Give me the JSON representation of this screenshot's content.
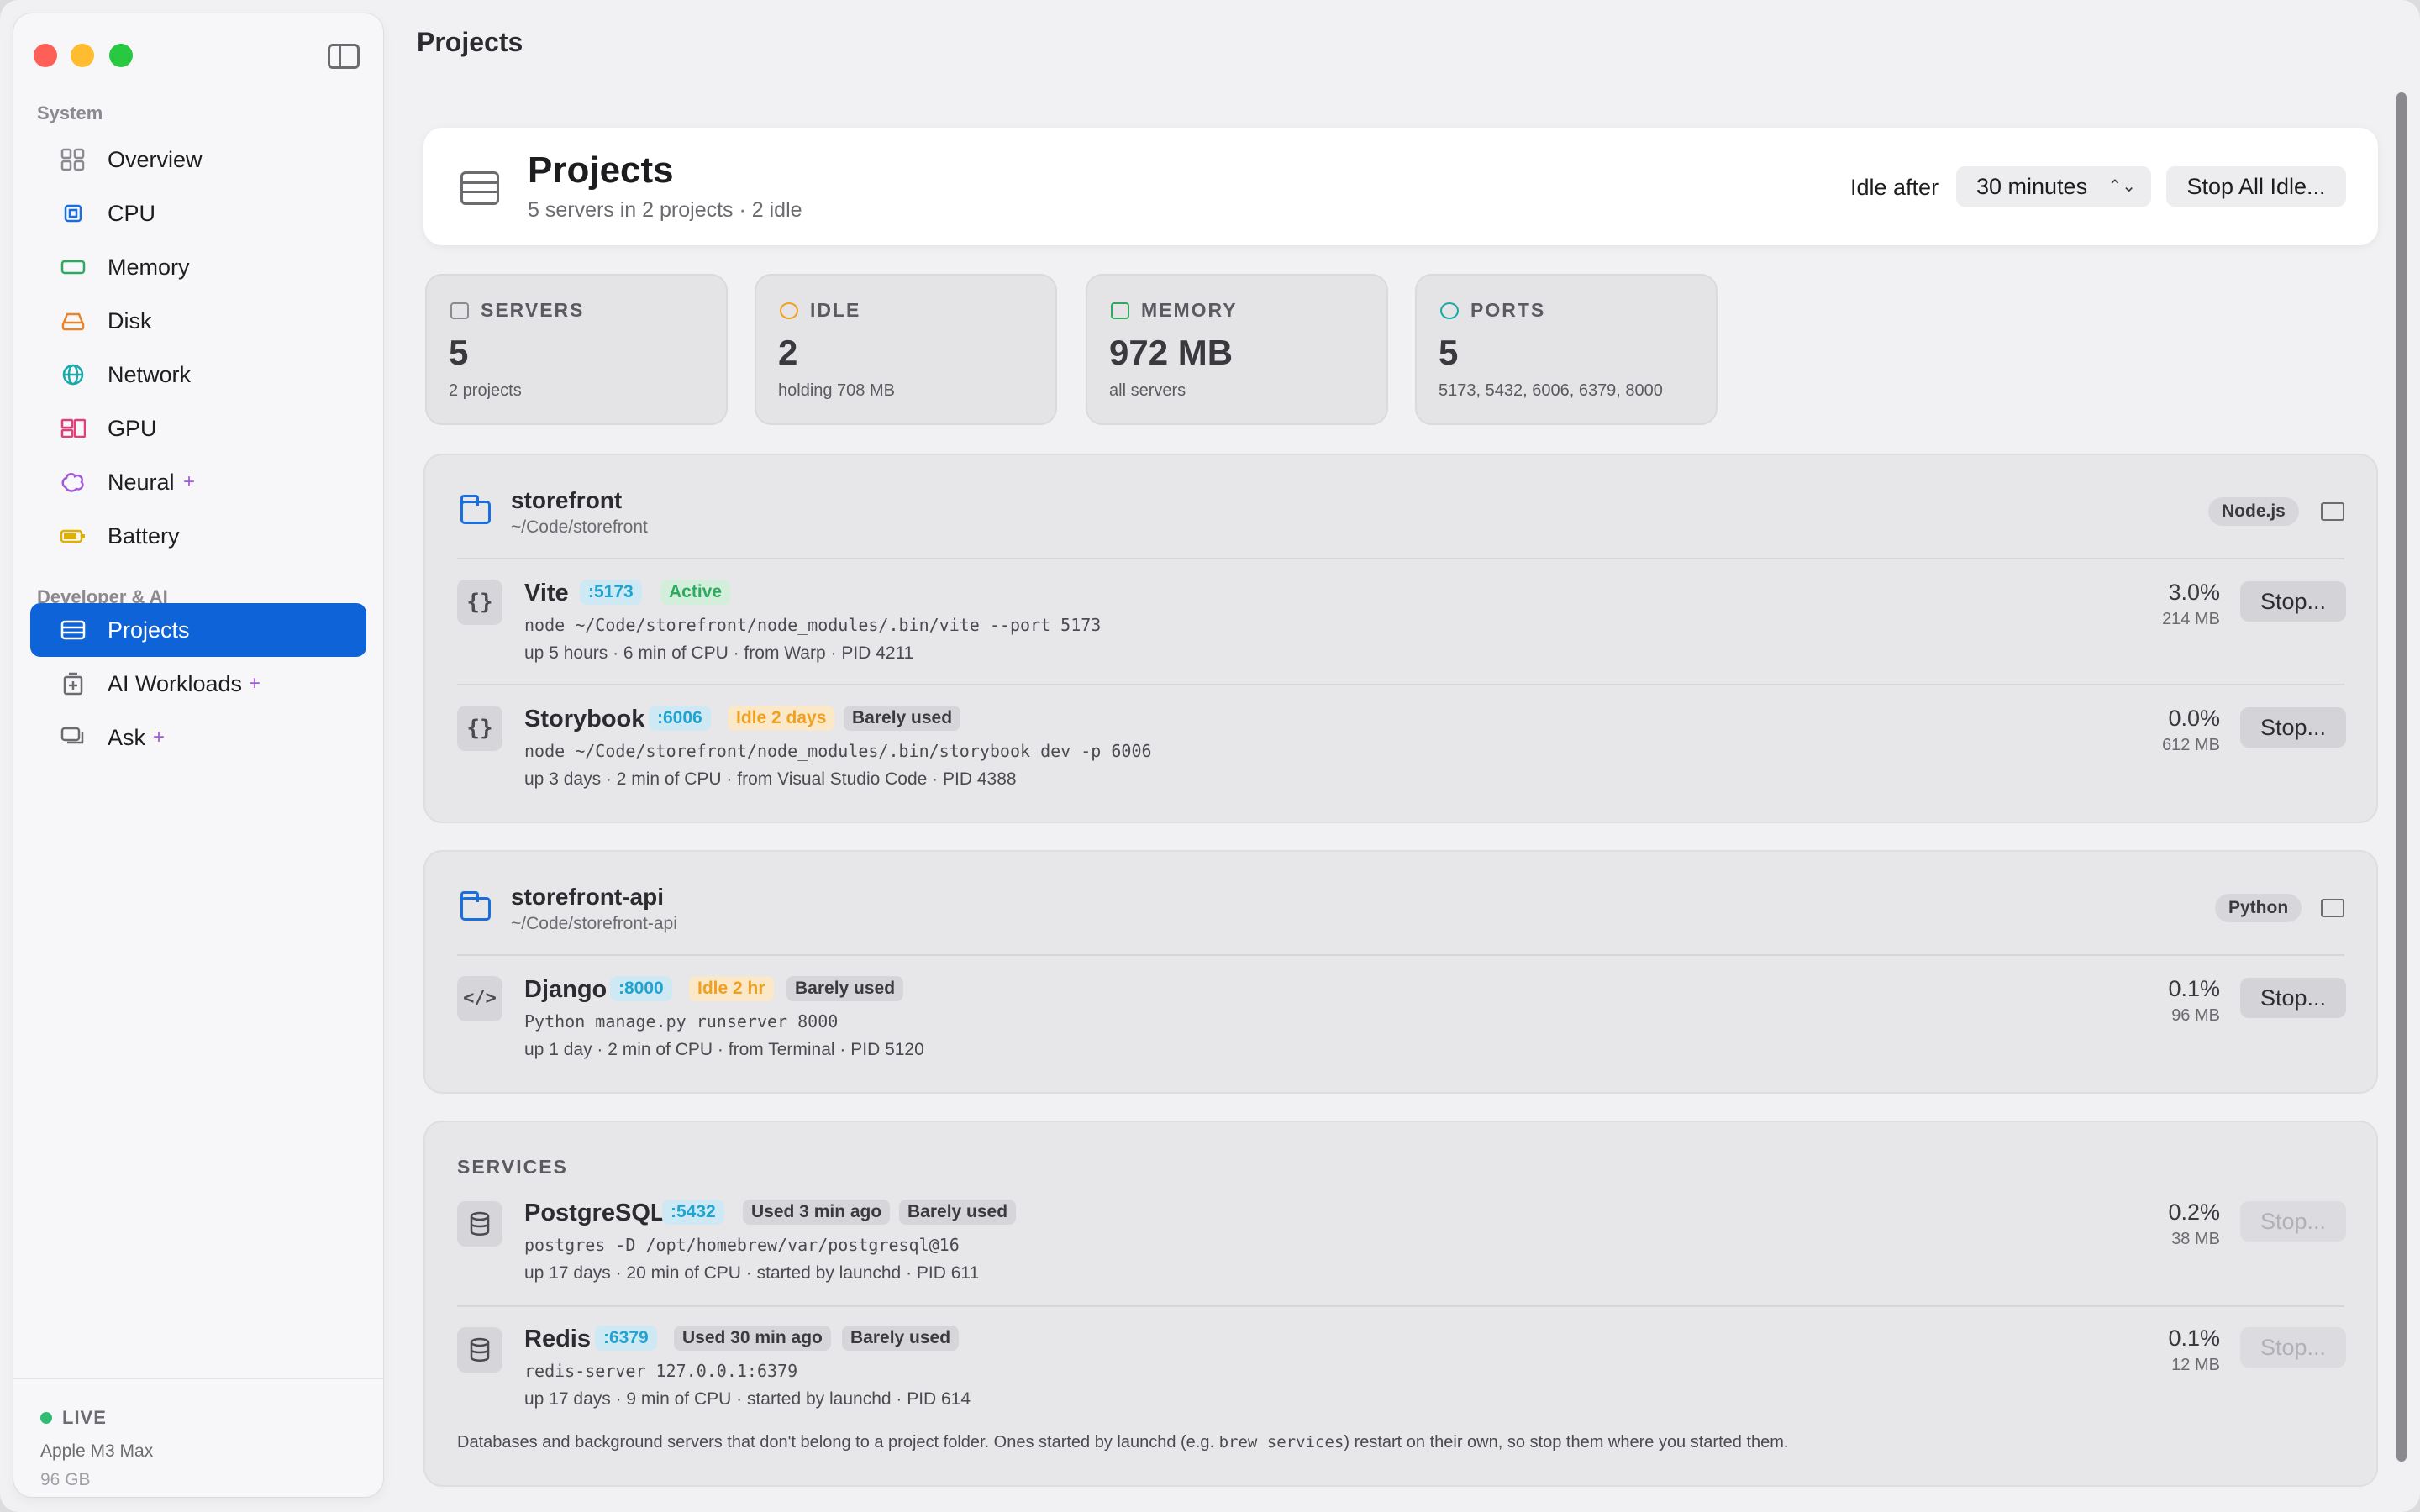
{
  "window": {
    "title": "Projects"
  },
  "colors": {
    "accent": "#0f63d8",
    "live": "#2ebd73",
    "port": "#1fa3d1",
    "active": "#2eaa5e",
    "idle": "#f0a020",
    "sparkle": "#a259d9"
  },
  "sidebar": {
    "sections": [
      {
        "label": "System"
      },
      {
        "label": "Developer & AI"
      }
    ],
    "items": [
      {
        "label": "Overview",
        "icon": "grid-icon"
      },
      {
        "label": "CPU",
        "icon": "chip-icon"
      },
      {
        "label": "Memory",
        "icon": "memory-icon"
      },
      {
        "label": "Disk",
        "icon": "disk-icon"
      },
      {
        "label": "Network",
        "icon": "globe-icon"
      },
      {
        "label": "GPU",
        "icon": "gpu-icon"
      },
      {
        "label": "Neural",
        "icon": "brain-icon",
        "sparkle": "+"
      },
      {
        "label": "Battery",
        "icon": "battery-icon"
      },
      {
        "label": "Projects",
        "icon": "server-icon",
        "active": true
      },
      {
        "label": "AI Workloads",
        "icon": "ai-icon",
        "sparkle": "+"
      },
      {
        "label": "Ask",
        "icon": "chat-icon",
        "sparkle": "+"
      }
    ],
    "footer": {
      "live": "LIVE",
      "chip": "Apple M3 Max",
      "memory": "96 GB"
    }
  },
  "header": {
    "title": "Projects",
    "subtitle": "5 servers in 2 projects · 2 idle",
    "idle_label": "Idle after",
    "idle_value": "30 minutes",
    "stop_all": "Stop All Idle..."
  },
  "stats": [
    {
      "label": "SERVERS",
      "value": "5",
      "sub": "2 projects"
    },
    {
      "label": "IDLE",
      "value": "2",
      "sub": "holding 708 MB"
    },
    {
      "label": "MEMORY",
      "value": "972 MB",
      "sub": "all servers"
    },
    {
      "label": "PORTS",
      "value": "5",
      "sub": "5173, 5432, 6006, 6379, 8000"
    }
  ],
  "groups": [
    {
      "name": "storefront",
      "path": "~/Code/storefront",
      "lang": "Node.js",
      "rows": [
        {
          "icon": "{}",
          "name": "Vite",
          "port": ":5173",
          "status": "Active",
          "cmd": "node ~/Code/storefront/node_modules/.bin/vite --port 5173",
          "meta": "up 5 hours · 6 min of CPU · from Warp · PID 4211",
          "cpu": "3.0%",
          "mem": "214 MB",
          "stop": "Stop..."
        },
        {
          "icon": "{}",
          "name": "Storybook",
          "port": ":6006",
          "status": "Idle 2 days",
          "usage": "Barely used",
          "cmd": "node ~/Code/storefront/node_modules/.bin/storybook dev -p 6006",
          "meta": "up 3 days · 2 min of CPU · from Visual Studio Code · PID 4388",
          "cpu": "0.0%",
          "mem": "612 MB",
          "stop": "Stop..."
        }
      ]
    },
    {
      "name": "storefront-api",
      "path": "~/Code/storefront-api",
      "lang": "Python",
      "rows": [
        {
          "icon": "</>",
          "name": "Django",
          "port": ":8000",
          "status": "Idle 2 hr",
          "usage": "Barely used",
          "cmd": "Python manage.py runserver 8000",
          "meta": "up 1 day · 2 min of CPU · from Terminal · PID 5120",
          "cpu": "0.1%",
          "mem": "96 MB",
          "stop": "Stop..."
        }
      ]
    }
  ],
  "services": {
    "title": "SERVICES",
    "rows": [
      {
        "name": "PostgreSQL",
        "port": ":5432",
        "used": "Used 3 min ago",
        "usage": "Barely used",
        "cmd": "postgres -D /opt/homebrew/var/postgresql@16",
        "meta": "up 17 days · 20 min of CPU · started by launchd · PID 611",
        "cpu": "0.2%",
        "mem": "38 MB",
        "stop": "Stop..."
      },
      {
        "name": "Redis",
        "port": ":6379",
        "used": "Used 30 min ago",
        "usage": "Barely used",
        "cmd": "redis-server 127.0.0.1:6379",
        "meta": "up 17 days · 9 min of CPU · started by launchd · PID 614",
        "cpu": "0.1%",
        "mem": "12 MB",
        "stop": "Stop..."
      }
    ],
    "footnote_pre": "Databases and background servers that don't belong to a project folder. Ones started by launchd (e.g. ",
    "footnote_code": "brew services",
    "footnote_post": ") restart on their own, so stop them where you started them."
  }
}
